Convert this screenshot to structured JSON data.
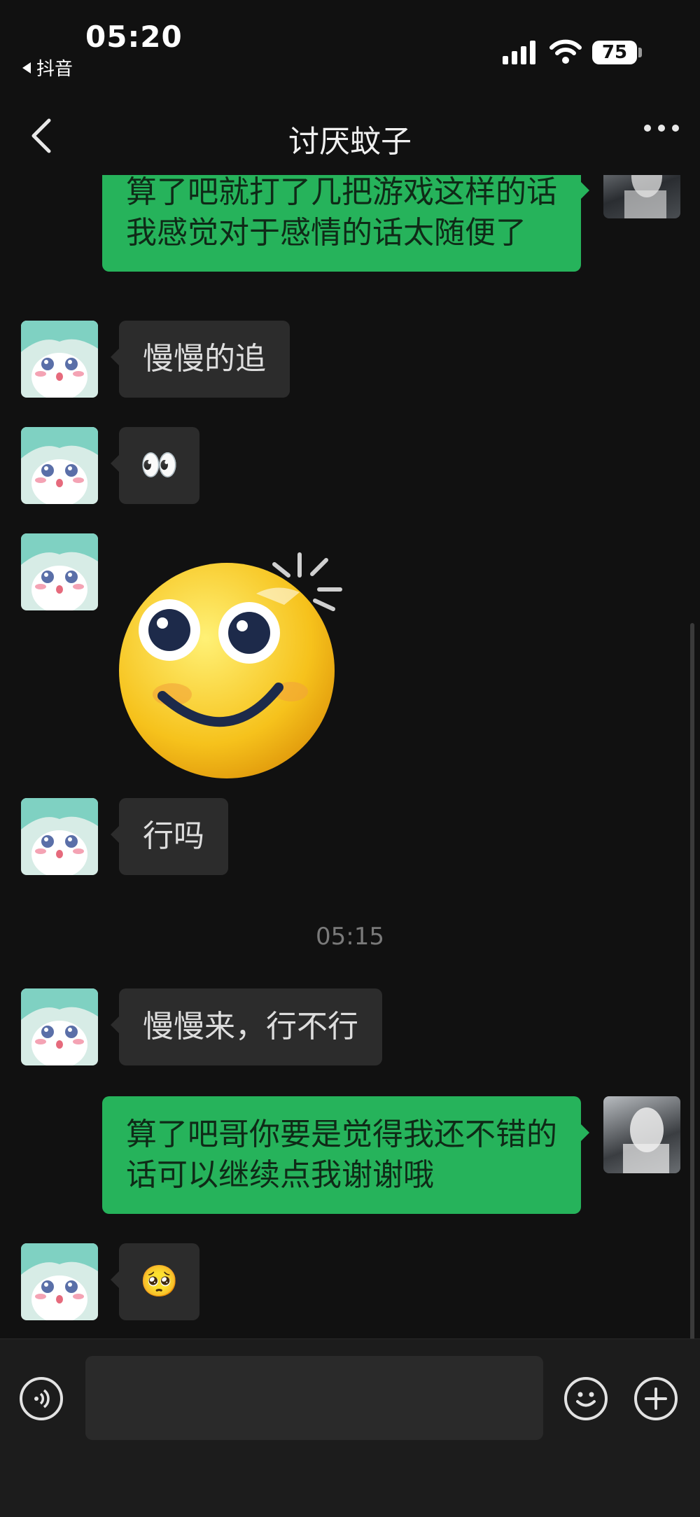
{
  "status_bar": {
    "time": "05:20",
    "back_app_label": "抖音",
    "battery": "75"
  },
  "header": {
    "title": "讨厌蚊子",
    "back_icon": "chevron-left-icon",
    "more_icon": "more-dots-icon"
  },
  "messages": [
    {
      "side": "out",
      "text": "算了吧就打了几把游戏这样的话我感觉对于感情的话太随便了"
    },
    {
      "side": "in",
      "text": "慢慢的追"
    },
    {
      "side": "in",
      "emoji": "👀"
    },
    {
      "side": "in",
      "sticker": "smiley-face-sticker"
    },
    {
      "side": "in",
      "text": "行吗"
    },
    {
      "type": "time",
      "text": "05:15"
    },
    {
      "side": "in",
      "text": "慢慢来，行不行"
    },
    {
      "side": "out",
      "text": "算了吧哥你要是觉得我还不错的话可以继续点我谢谢哦"
    },
    {
      "side": "in",
      "emoji": "🥺"
    }
  ],
  "input_bar": {
    "voice_icon": "voice-icon",
    "emoji_icon": "emoji-icon",
    "plus_icon": "plus-icon",
    "placeholder": ""
  },
  "colors": {
    "background": "#111111",
    "incoming_bubble": "#2c2c2c",
    "outgoing_bubble": "#26b35b",
    "input_bar": "#1c1c1c"
  }
}
